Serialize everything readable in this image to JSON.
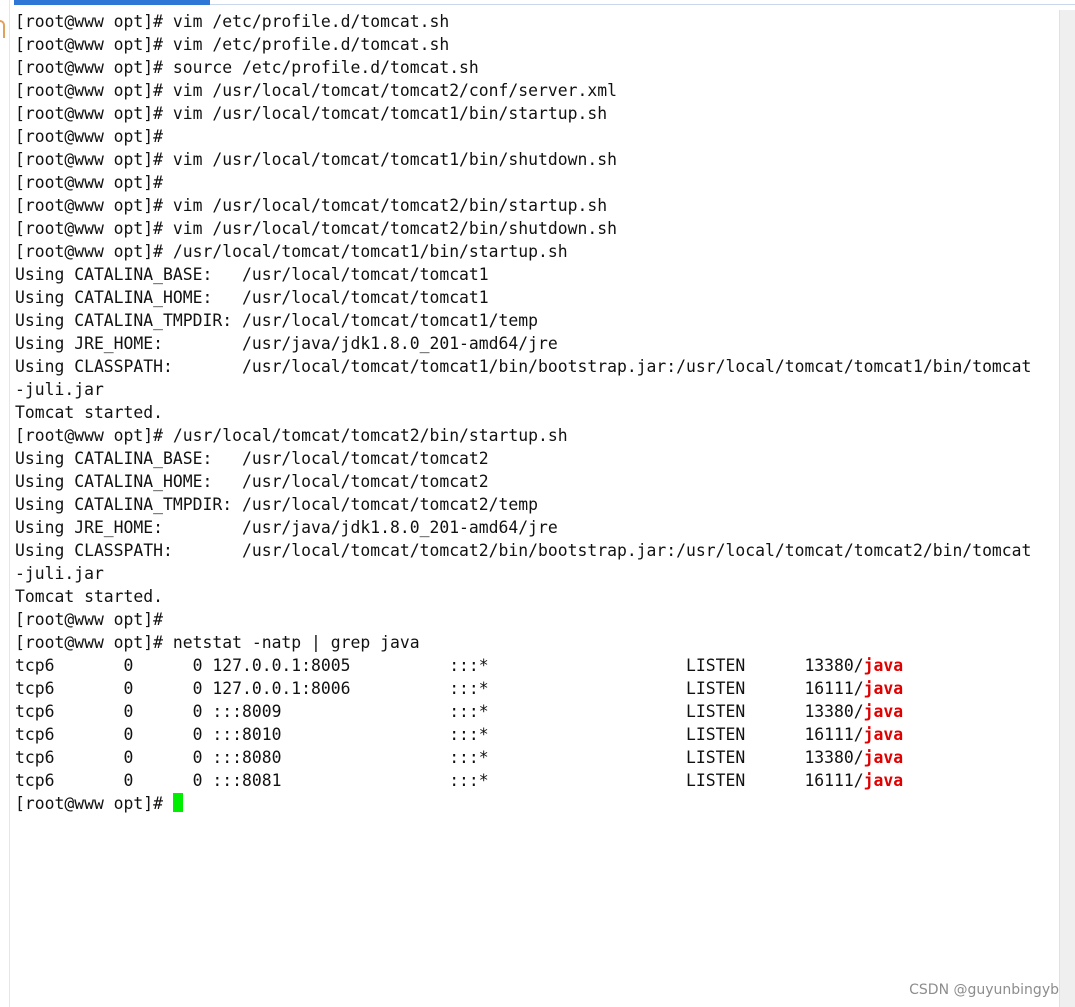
{
  "terminal": {
    "lines": [
      {
        "segments": [
          {
            "text": "[root@www opt]# vim /etc/profile.d/tomcat.sh"
          }
        ]
      },
      {
        "segments": [
          {
            "text": "[root@www opt]# vim /etc/profile.d/tomcat.sh"
          }
        ]
      },
      {
        "segments": [
          {
            "text": "[root@www opt]# source /etc/profile.d/tomcat.sh"
          }
        ]
      },
      {
        "segments": [
          {
            "text": "[root@www opt]# vim /usr/local/tomcat/tomcat2/conf/server.xml"
          }
        ]
      },
      {
        "segments": [
          {
            "text": "[root@www opt]# vim /usr/local/tomcat/tomcat1/bin/startup.sh"
          }
        ]
      },
      {
        "segments": [
          {
            "text": "[root@www opt]#"
          }
        ]
      },
      {
        "segments": [
          {
            "text": "[root@www opt]# vim /usr/local/tomcat/tomcat1/bin/shutdown.sh"
          }
        ]
      },
      {
        "segments": [
          {
            "text": "[root@www opt]#"
          }
        ]
      },
      {
        "segments": [
          {
            "text": "[root@www opt]# vim /usr/local/tomcat/tomcat2/bin/startup.sh"
          }
        ]
      },
      {
        "segments": [
          {
            "text": "[root@www opt]# vim /usr/local/tomcat/tomcat2/bin/shutdown.sh"
          }
        ]
      },
      {
        "segments": [
          {
            "text": "[root@www opt]# /usr/local/tomcat/tomcat1/bin/startup.sh"
          }
        ]
      },
      {
        "segments": [
          {
            "text": "Using CATALINA_BASE:   /usr/local/tomcat/tomcat1"
          }
        ]
      },
      {
        "segments": [
          {
            "text": "Using CATALINA_HOME:   /usr/local/tomcat/tomcat1"
          }
        ]
      },
      {
        "segments": [
          {
            "text": "Using CATALINA_TMPDIR: /usr/local/tomcat/tomcat1/temp"
          }
        ]
      },
      {
        "segments": [
          {
            "text": "Using JRE_HOME:        /usr/java/jdk1.8.0_201-amd64/jre"
          }
        ]
      },
      {
        "segments": [
          {
            "text": "Using CLASSPATH:       /usr/local/tomcat/tomcat1/bin/bootstrap.jar:/usr/local/tomcat/tomcat1/bin/tomcat"
          }
        ]
      },
      {
        "segments": [
          {
            "text": "-juli.jar"
          }
        ]
      },
      {
        "segments": [
          {
            "text": "Tomcat started."
          }
        ]
      },
      {
        "segments": [
          {
            "text": "[root@www opt]# /usr/local/tomcat/tomcat2/bin/startup.sh"
          }
        ]
      },
      {
        "segments": [
          {
            "text": "Using CATALINA_BASE:   /usr/local/tomcat/tomcat2"
          }
        ]
      },
      {
        "segments": [
          {
            "text": "Using CATALINA_HOME:   /usr/local/tomcat/tomcat2"
          }
        ]
      },
      {
        "segments": [
          {
            "text": "Using CATALINA_TMPDIR: /usr/local/tomcat/tomcat2/temp"
          }
        ]
      },
      {
        "segments": [
          {
            "text": "Using JRE_HOME:        /usr/java/jdk1.8.0_201-amd64/jre"
          }
        ]
      },
      {
        "segments": [
          {
            "text": "Using CLASSPATH:       /usr/local/tomcat/tomcat2/bin/bootstrap.jar:/usr/local/tomcat/tomcat2/bin/tomcat"
          }
        ]
      },
      {
        "segments": [
          {
            "text": "-juli.jar"
          }
        ]
      },
      {
        "segments": [
          {
            "text": "Tomcat started."
          }
        ]
      },
      {
        "segments": [
          {
            "text": "[root@www opt]#"
          }
        ]
      },
      {
        "segments": [
          {
            "text": "[root@www opt]# netstat -natp | grep java"
          }
        ]
      },
      {
        "segments": [
          {
            "text": "tcp6       0      0 127.0.0.1:8005          :::*                    LISTEN      13380/"
          },
          {
            "text": "java",
            "highlight": true
          }
        ]
      },
      {
        "segments": [
          {
            "text": "tcp6       0      0 127.0.0.1:8006          :::*                    LISTEN      16111/"
          },
          {
            "text": "java",
            "highlight": true
          }
        ]
      },
      {
        "segments": [
          {
            "text": "tcp6       0      0 :::8009                 :::*                    LISTEN      13380/"
          },
          {
            "text": "java",
            "highlight": true
          }
        ]
      },
      {
        "segments": [
          {
            "text": "tcp6       0      0 :::8010                 :::*                    LISTEN      16111/"
          },
          {
            "text": "java",
            "highlight": true
          }
        ]
      },
      {
        "segments": [
          {
            "text": "tcp6       0      0 :::8080                 :::*                    LISTEN      13380/"
          },
          {
            "text": "java",
            "highlight": true
          }
        ]
      },
      {
        "segments": [
          {
            "text": "tcp6       0      0 :::8081                 :::*                    LISTEN      16111/"
          },
          {
            "text": "java",
            "highlight": true
          }
        ]
      },
      {
        "segments": [
          {
            "text": "[root@www opt]# "
          }
        ],
        "cursor": true
      }
    ]
  },
  "watermark": "CSDN @guyunbingyb",
  "colors": {
    "highlight": "#e00000",
    "cursor": "#00ee00",
    "tab_accent": "#2f77d6"
  }
}
